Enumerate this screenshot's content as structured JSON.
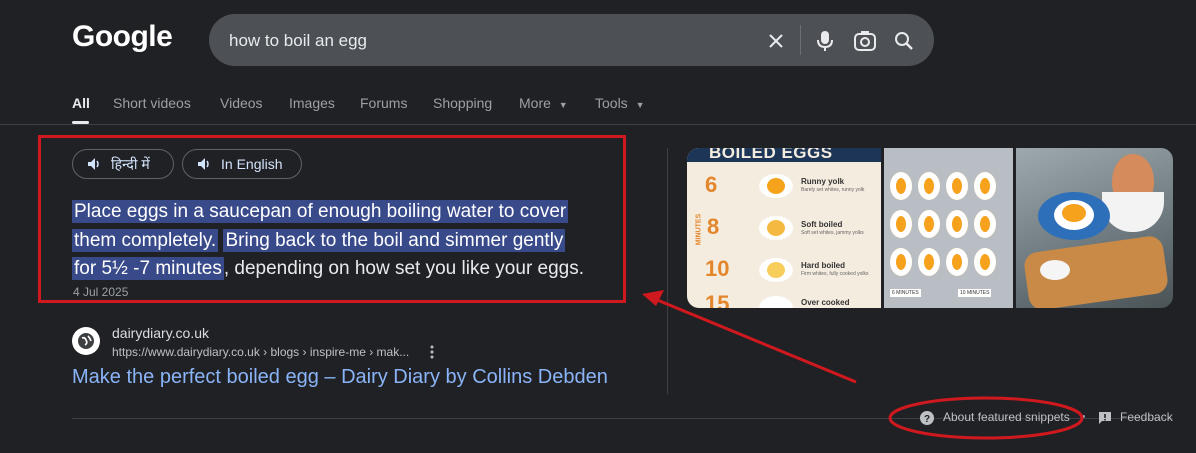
{
  "logo": "Google",
  "search": {
    "query": "how to boil an egg"
  },
  "tabs": [
    {
      "label": "All"
    },
    {
      "label": "Short videos"
    },
    {
      "label": "Videos"
    },
    {
      "label": "Images"
    },
    {
      "label": "Forums"
    },
    {
      "label": "Shopping"
    },
    {
      "label": "More"
    },
    {
      "label": "Tools"
    }
  ],
  "snippet": {
    "audio_hindi": "हिन्दी में",
    "audio_english": "In English",
    "hl1": "Place eggs in a saucepan of enough boiling water to cover",
    "hl2": "them completely.",
    "hl3": "Bring back to the boil and simmer gently",
    "hl4": "for 5½ -7 minutes",
    "tail": ", depending on how set you like your eggs.",
    "date": "4 Jul 2025"
  },
  "source": {
    "site": "dairydiary.co.uk",
    "url": "https://www.dairydiary.co.uk › blogs › inspire-me › mak...",
    "title": "Make the perfect boiled egg – Dairy Diary by Collins Debden"
  },
  "image1": {
    "heading": "BOILED EGGS",
    "rows": [
      {
        "num": "6",
        "label": "Runny yolk",
        "desc": "Barely set whites, runny yolk"
      },
      {
        "num": "8",
        "label": "Soft boiled",
        "desc": "Soft set whites, jammy yolks"
      },
      {
        "num": "10",
        "label": "Hard boiled",
        "desc": "Firm whites, fully cooked yolks"
      },
      {
        "num": "15",
        "label": "Over cooked",
        "desc": ""
      }
    ],
    "side_text": "MINUTES"
  },
  "image2": {
    "caption1": "6 MINUTES",
    "caption2": "10 MINUTES"
  },
  "footer": {
    "about": "About featured snippets",
    "feedback": "Feedback"
  },
  "colors": {
    "background": "#202124",
    "highlight": "#394a8a",
    "link": "#8ab4f8",
    "annotation": "#d0191e"
  }
}
